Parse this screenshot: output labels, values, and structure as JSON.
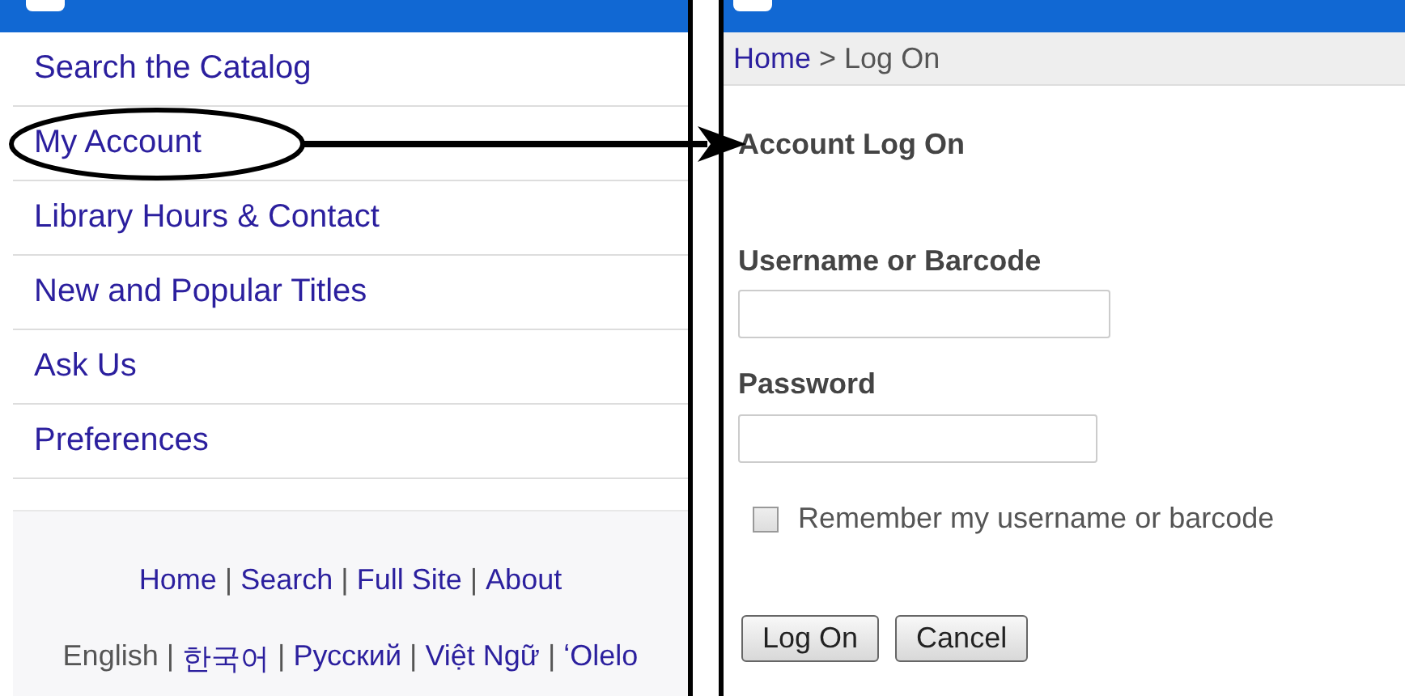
{
  "menu": {
    "items": [
      {
        "label": "Search the Catalog",
        "highlighted": false
      },
      {
        "label": "My Account",
        "highlighted": true
      },
      {
        "label": "Library Hours & Contact",
        "highlighted": false
      },
      {
        "label": "New and Popular Titles",
        "highlighted": false
      },
      {
        "label": "Ask Us",
        "highlighted": false
      },
      {
        "label": "Preferences",
        "highlighted": false
      }
    ]
  },
  "footer": {
    "separator": "|",
    "links": [
      "Home",
      "Search",
      "Full Site",
      "About"
    ],
    "languages": [
      "English",
      "한국어",
      "Русский",
      "Việt Ngữ",
      "ʻOlelo"
    ]
  },
  "breadcrumb": {
    "items": [
      "Home",
      "Log On"
    ],
    "separator": ">"
  },
  "login": {
    "title": "Account Log On",
    "fields": [
      {
        "label": "Username or Barcode",
        "kind": "text"
      },
      {
        "label": "Password",
        "kind": "password"
      }
    ],
    "remember": {
      "label": "Remember my username or barcode",
      "checked": false
    },
    "buttons": [
      "Log On",
      "Cancel"
    ]
  }
}
